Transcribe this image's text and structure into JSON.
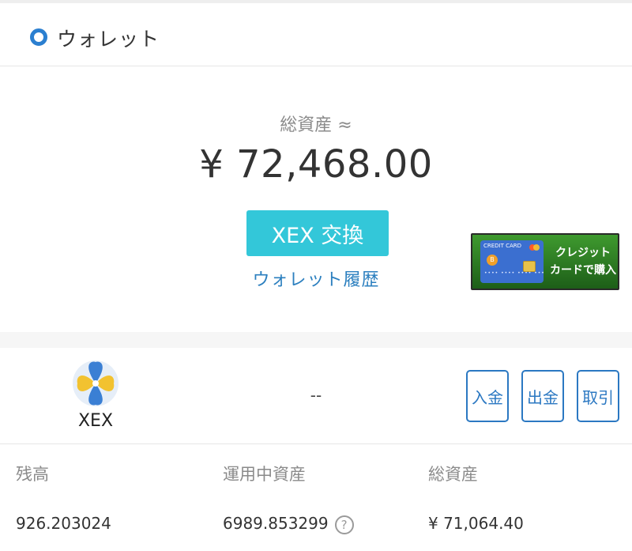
{
  "header": {
    "icon": "circle-icon",
    "title": "ウォレット"
  },
  "summary": {
    "total_label": "総資産 ≈",
    "total_value": "¥ 72,468.00",
    "exchange_button": "XEX 交換",
    "history_link": "ウォレット履歴"
  },
  "banner": {
    "card_label": "CREDIT CARD",
    "coin_symbol": "B",
    "text_line1": "クレジット",
    "text_line2": "カードで購入"
  },
  "asset": {
    "coin_name": "XEX",
    "coin_logo": "xex-logo",
    "middle_value": "--",
    "actions": {
      "deposit": "入金",
      "withdraw": "出金",
      "trade": "取引"
    }
  },
  "stats": {
    "balance_label": "残高",
    "balance_value": "926.203024",
    "staking_label": "運用中資産",
    "staking_value": "6989.853299",
    "help_icon": "?",
    "total_label": "総資産",
    "total_value": "¥ 71,064.40"
  },
  "colors": {
    "accent": "#33c7d9",
    "link": "#2b7fbf",
    "action_border": "#2b78c2",
    "banner_green": "#2f7f24"
  }
}
